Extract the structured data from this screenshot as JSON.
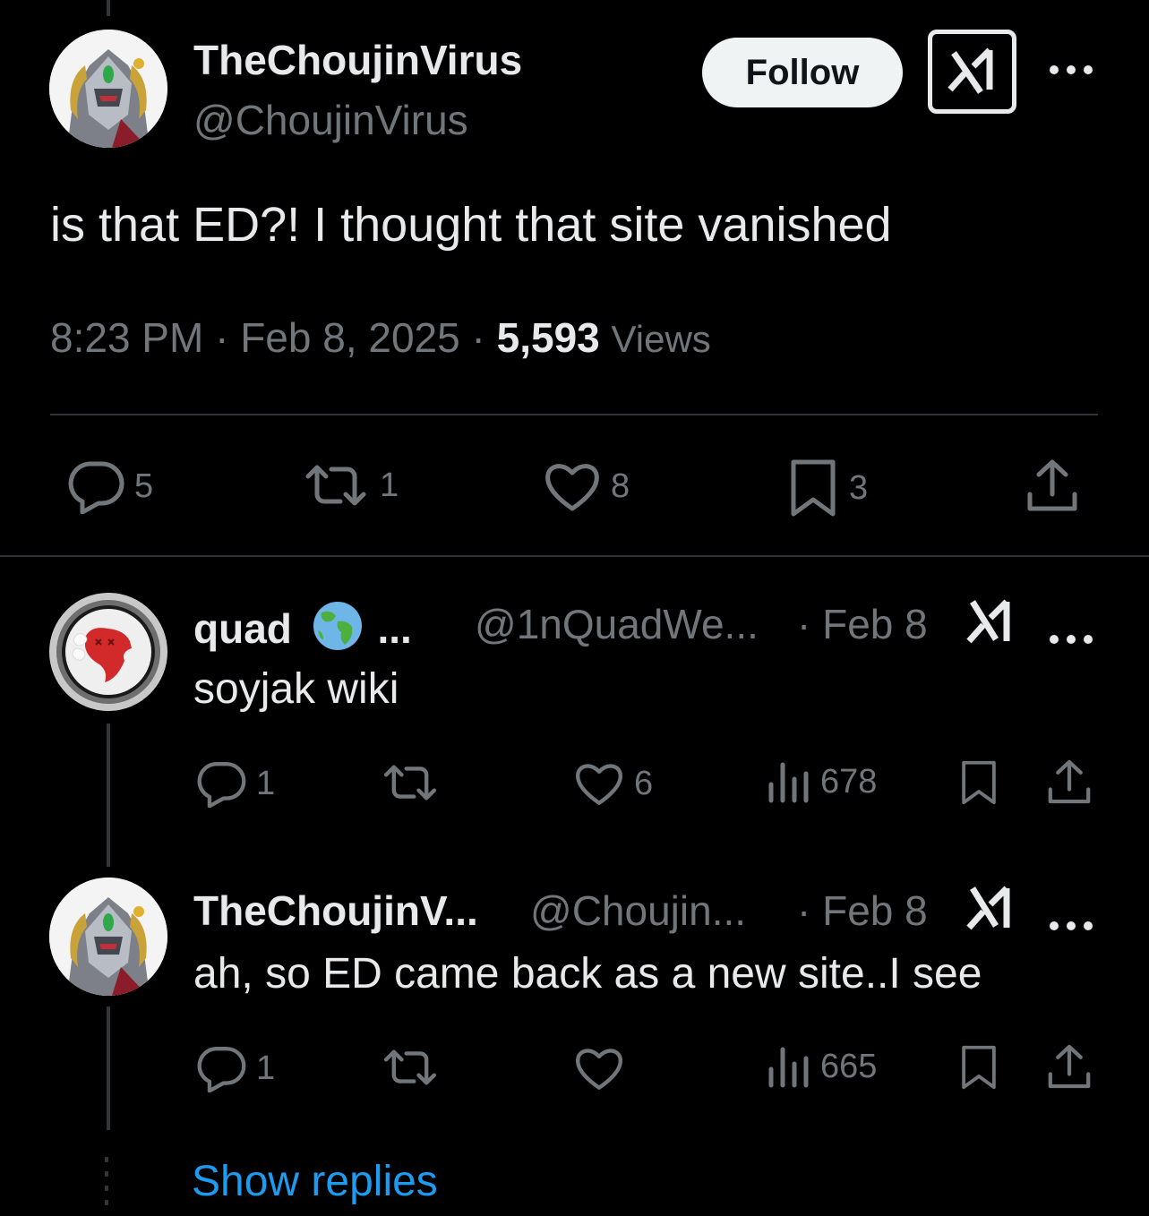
{
  "main_tweet": {
    "display_name": "TheChoujinVirus",
    "handle": "@ChoujinVirus",
    "follow_label": "Follow",
    "text": "is that ED?! I thought that site vanished",
    "time": "8:23 PM",
    "date": "Feb 8, 2025",
    "views_count": "5,593",
    "views_label": "Views",
    "separator": "·",
    "replies": "5",
    "reposts": "1",
    "likes": "8",
    "bookmarks": "3",
    "avatar_icon": "armored-robot-avatar",
    "grok_icon": "grok-icon"
  },
  "replies": [
    {
      "display_name": "quad",
      "name_suffix": "...",
      "globe_icon": "globe-emoji-icon",
      "handle": "@1nQuadWe...",
      "date": "· Feb 8",
      "text": "soyjak wiki",
      "replies": "1",
      "reposts": "",
      "likes": "6",
      "views": "678",
      "avatar_icon": "red-ghost-avatar"
    },
    {
      "display_name": "TheChoujinV...",
      "handle": "@Choujin...",
      "date": "· Feb 8",
      "text": "ah, so ED came back as a new site..I see",
      "replies": "1",
      "reposts": "",
      "likes": "",
      "views": "665",
      "avatar_icon": "armored-robot-avatar"
    }
  ],
  "show_replies_label": "Show replies",
  "colors": {
    "background": "#000000",
    "text_primary": "#e7e9ea",
    "text_secondary": "#71767b",
    "link": "#1d9bf0",
    "divider": "#2f3336"
  }
}
